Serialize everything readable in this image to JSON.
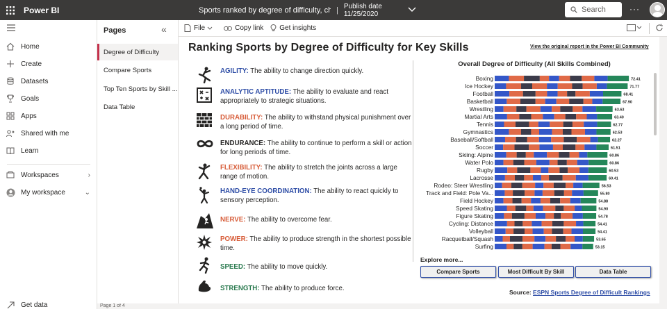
{
  "topbar": {
    "app_name": "Power BI",
    "report_title": "Sports ranked by degree of difficulty, choose t...",
    "publish_label": "Publish date",
    "publish_date": "11/25/2020",
    "search_placeholder": "Search",
    "more": "···"
  },
  "nav": {
    "items": [
      {
        "label": "Home",
        "icon": "home-icon"
      },
      {
        "label": "Create",
        "icon": "plus-icon"
      },
      {
        "label": "Datasets",
        "icon": "dataset-icon"
      },
      {
        "label": "Goals",
        "icon": "trophy-icon"
      },
      {
        "label": "Apps",
        "icon": "apps-icon"
      },
      {
        "label": "Shared with me",
        "icon": "shared-icon"
      },
      {
        "label": "Learn",
        "icon": "book-icon"
      },
      {
        "label": "Workspaces",
        "icon": "workspaces-icon"
      },
      {
        "label": "My workspace",
        "icon": "my-workspace-icon"
      }
    ],
    "get_data": "Get data"
  },
  "pages": {
    "title": "Pages",
    "items": [
      "Degree of Difficulty",
      "Compare Sports",
      "Top Ten Sports by Skill ...",
      "Data Table"
    ],
    "active_index": 0,
    "footer": "Page 1 of 4"
  },
  "toolbar": {
    "file": "File",
    "copy_link": "Copy link",
    "get_insights": "Get insights"
  },
  "report": {
    "title": "Ranking Sports by Degree of Difficulty for Key Skills",
    "original_link": "View the original report in the Power BI Community",
    "skills": [
      {
        "name": "AGILITY:",
        "desc": "The ability to change direction quickly.",
        "color": "#2e4da6",
        "icon": "agility-icon"
      },
      {
        "name": "ANALYTIC APTITUDE:",
        "desc": "The ability to evaluate and react appropriately to strategic situations.",
        "color": "#2e4da6",
        "icon": "analytic-icon"
      },
      {
        "name": "DURABILITY:",
        "desc": "The ability to withstand physical punishment over a long period of time.",
        "color": "#d75c38",
        "icon": "durability-icon"
      },
      {
        "name": "ENDURANCE:",
        "desc": "The ability to continue to perform a skill or action for long periods of time.",
        "color": "#252423",
        "icon": "endurance-icon"
      },
      {
        "name": "FLEXIBILITY:",
        "desc": "The ability to stretch the joints across a large range of motion.",
        "color": "#d75c38",
        "icon": "flexibility-icon"
      },
      {
        "name": "HAND-EYE COORDINATION:",
        "desc": "The ability to react quickly to sensory perception.",
        "color": "#2e4da6",
        "icon": "hand-eye-icon"
      },
      {
        "name": "NERVE:",
        "desc": "The ability to overcome fear.",
        "color": "#d75c38",
        "icon": "nerve-icon"
      },
      {
        "name": "POWER:",
        "desc": "The ability to produce strength in the shortest possible time.",
        "color": "#d75c38",
        "icon": "power-icon"
      },
      {
        "name": "SPEED:",
        "desc": "The ability to move quickly.",
        "color": "#2a7a4f",
        "icon": "speed-icon"
      },
      {
        "name": "STRENGTH:",
        "desc": "The ability to produce force.",
        "color": "#2a7a4f",
        "icon": "strength-icon"
      }
    ],
    "explore_label": "Explore more...",
    "buttons": [
      "Compare Sports",
      "Most Difficult By Skill",
      "Data Table"
    ],
    "source_label": "Source:",
    "source_link": "ESPN Sports Degree of Difficult Rankings"
  },
  "chart_data": {
    "type": "bar",
    "orientation": "horizontal-stacked",
    "title": "Overall Degree of Difficulty (All Skills Combined)",
    "categories": [
      "Boxing",
      "Ice Hockey",
      "Football",
      "Basketball",
      "Wrestling",
      "Martial Arts",
      "Tennis",
      "Gymnastics",
      "Baseball/Softball",
      "Soccer",
      "Skiing: Alpine",
      "Water Polo",
      "Rugby",
      "Lacrosse",
      "Rodeo: Steer Wrestling",
      "Track and Field: Pole Va...",
      "Field Hockey",
      "Speed Skating",
      "Figure Skating",
      "Cycling: Distance",
      "Volleyball",
      "Racquetball/Squash",
      "Surfing"
    ],
    "totals": [
      "72.41",
      "71.77",
      "68.41",
      "67.90",
      "63.63",
      "63.40",
      "62.77",
      "62.53",
      "62.27",
      "61.51",
      "60.86",
      "60.86",
      "60.53",
      "60.41",
      "56.53",
      "55.80",
      "54.88",
      "54.90",
      "54.78",
      "54.41",
      "54.41",
      "53.65",
      "53.15"
    ],
    "segment_colors": [
      "#3457c8",
      "#e06a47",
      "#3c3b4a",
      "#e06a47",
      "#3457c8",
      "#e06a47",
      "#3c3b4a",
      "#e06a47",
      "#3457c8",
      "#25875a"
    ],
    "xlim": [
      0,
      75
    ]
  }
}
